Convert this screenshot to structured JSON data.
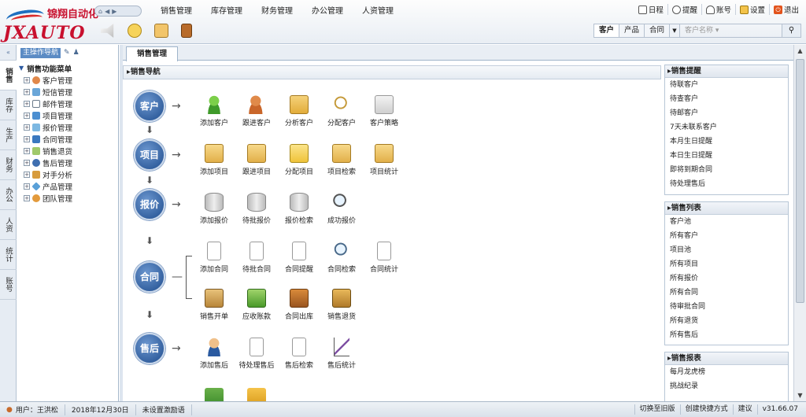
{
  "brand": {
    "cn": "锦翔自动化",
    "en": "JXAUTO"
  },
  "top_menu": [
    "销售管理",
    "库存管理",
    "财务管理",
    "办公管理",
    "人资管理"
  ],
  "top_tools": [
    {
      "icon": "calendar-icon",
      "label": "日程"
    },
    {
      "icon": "clock-icon",
      "label": "提醒"
    },
    {
      "icon": "user-icon",
      "label": "账号"
    },
    {
      "icon": "settings-icon",
      "label": "设置"
    },
    {
      "icon": "power-icon",
      "label": "退出"
    }
  ],
  "search": {
    "tabs": [
      "客户",
      "产品",
      "合同"
    ],
    "placeholder": "客户名称 ▾"
  },
  "left_tabs": [
    "销售",
    "库存",
    "生产",
    "财务",
    "办公",
    "人资",
    "统计",
    "账号"
  ],
  "left_header": "主操作导航",
  "tree": {
    "root": "销售功能菜单",
    "items": [
      "客户管理",
      "短信管理",
      "邮件管理",
      "项目管理",
      "报价管理",
      "合同管理",
      "销售退货",
      "售后管理",
      "对手分析",
      "产品管理",
      "团队管理"
    ]
  },
  "page_tab": "销售管理",
  "nav_title": "销售导航",
  "flow": [
    {
      "stage": "客户",
      "items": [
        "添加客户",
        "跟进客户",
        "分析客户",
        "分配客户",
        "客户策略"
      ]
    },
    {
      "stage": "项目",
      "items": [
        "添加项目",
        "跟进项目",
        "分配项目",
        "项目检索",
        "项目统计"
      ]
    },
    {
      "stage": "报价",
      "items": [
        "添加报价",
        "待批报价",
        "报价检索",
        "成功报价"
      ]
    },
    {
      "stage": "合同",
      "items": [
        "添加合同",
        "待批合同",
        "合同提醒",
        "合同检索",
        "合同统计",
        "销售开单",
        "应收账款",
        "合同出库",
        "销售退货"
      ]
    },
    {
      "stage": "售后",
      "items": [
        "添加售后",
        "待处理售后",
        "售后检索",
        "售后统计"
      ]
    }
  ],
  "right": {
    "reminder": {
      "title": "销售提醒",
      "items": [
        "待联客户",
        "待查客户",
        "待邮客户",
        "7天未联系客户",
        "本月生日提醒",
        "本日生日提醒",
        "即将到期合同",
        "待处理售后"
      ]
    },
    "lists": {
      "title": "销售列表",
      "items": [
        "客户池",
        "所有客户",
        "项目池",
        "所有项目",
        "所有报价",
        "所有合同",
        "待审批合同",
        "所有退货",
        "所有售后"
      ]
    },
    "reports": {
      "title": "销售报表",
      "items": [
        "每月龙虎榜",
        "挑战纪录"
      ]
    }
  },
  "status": {
    "user": "用户：王洪松",
    "date": "2018年12月30日",
    "motto": "未设置激励语",
    "right": [
      "切换至旧版",
      "创建快捷方式",
      "建议",
      "v31.66.07"
    ]
  }
}
